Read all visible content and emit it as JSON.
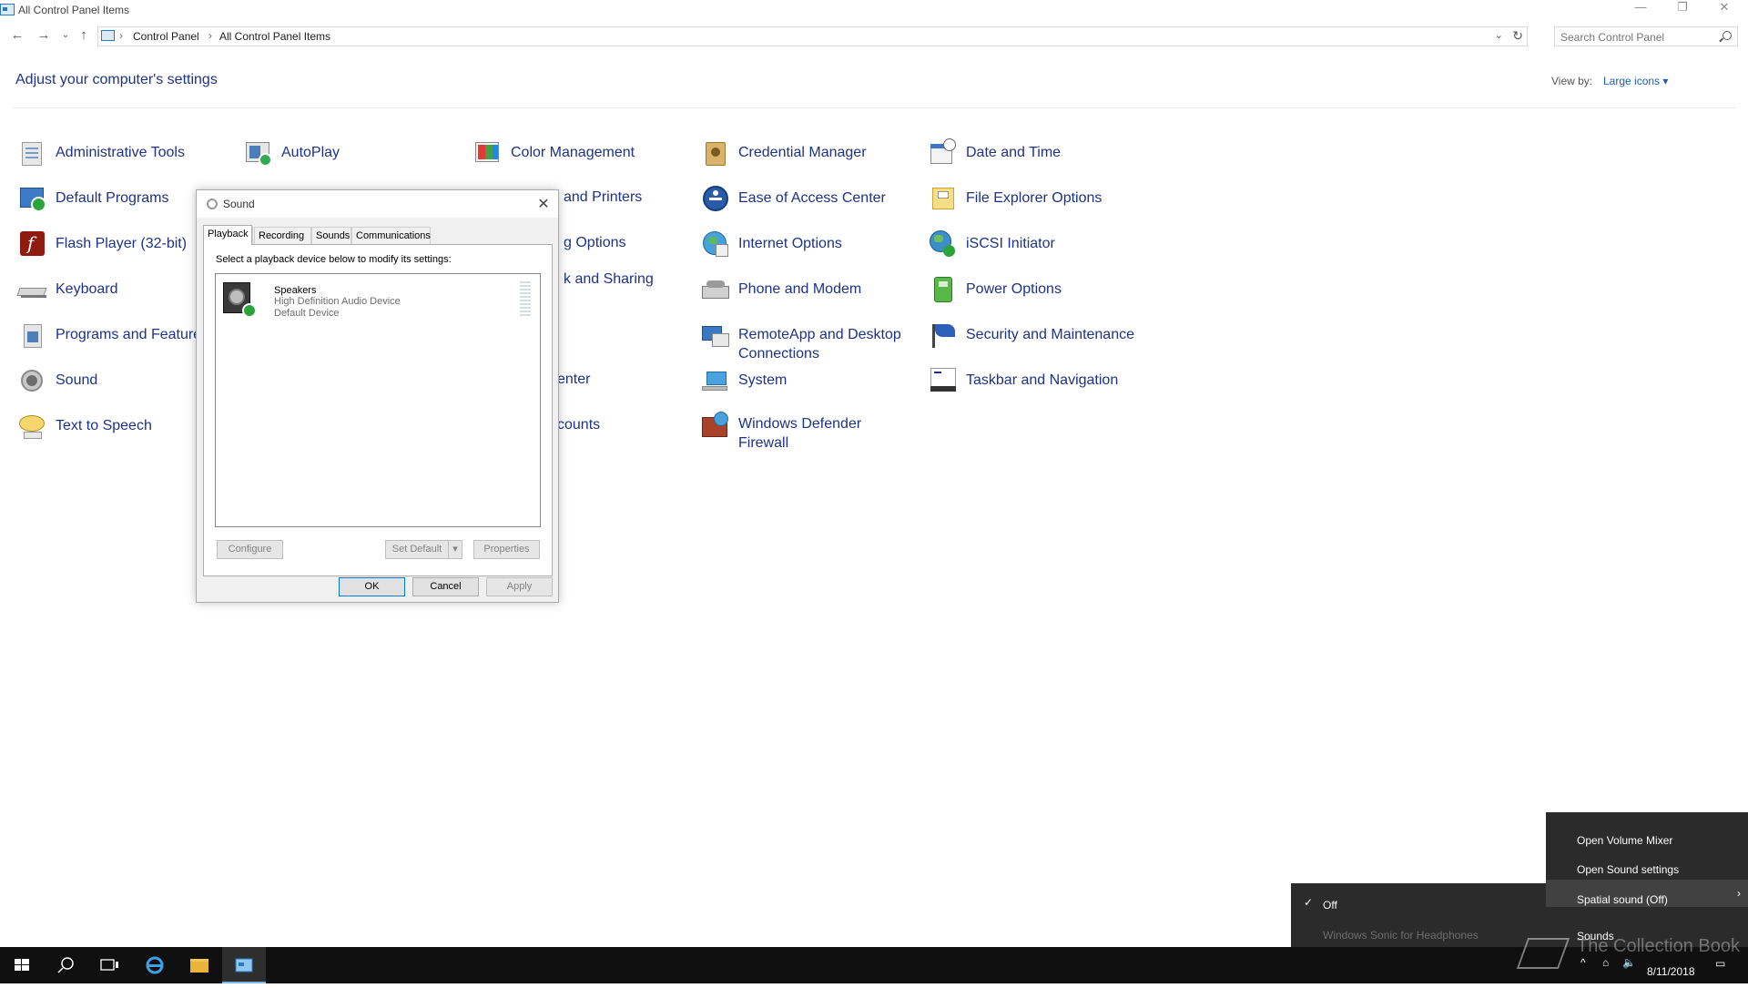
{
  "window": {
    "title": "All Control Panel Items",
    "minimize": "—",
    "restore": "❐",
    "close": "✕"
  },
  "address": {
    "crumbs": [
      "Control Panel",
      "All Control Panel Items"
    ],
    "separator": "›",
    "search_placeholder": "Search Control Panel"
  },
  "header": {
    "title": "Adjust your computer's settings",
    "view_by_label": "View by:",
    "view_by_value": "Large icons ▾"
  },
  "items": {
    "col1": [
      "Administrative Tools",
      "Default Programs",
      "Flash Player (32-bit)",
      "Keyboard",
      "Programs and Features",
      "Sound",
      "Text to Speech"
    ],
    "col2": [
      "AutoPlay"
    ],
    "col3": [
      "Color Management",
      "and Printers",
      "g Options",
      "k and Sharing",
      "enter",
      "counts"
    ],
    "col4": [
      "Credential Manager",
      "Ease of Access Center",
      "Internet Options",
      "Phone and Modem",
      "RemoteApp and Desktop",
      "Connections",
      "System",
      "Windows Defender",
      "Firewall"
    ],
    "col5": [
      "Date and Time",
      "File Explorer Options",
      "iSCSI Initiator",
      "Power Options",
      "Security and Maintenance",
      "Taskbar and Navigation"
    ]
  },
  "sound_dialog": {
    "title": "Sound",
    "close": "✕",
    "tabs": [
      "Playback",
      "Recording",
      "Sounds",
      "Communications"
    ],
    "instruction": "Select a playback device below to modify its settings:",
    "device": {
      "name": "Speakers",
      "description": "High Definition Audio Device",
      "status": "Default Device"
    },
    "buttons": {
      "configure": "Configure",
      "set_default": "Set Default",
      "properties": "Properties",
      "ok": "OK",
      "cancel": "Cancel",
      "apply": "Apply"
    }
  },
  "context_menu": {
    "items": [
      "Open Volume Mixer",
      "Open Sound settings",
      "Spatial sound (Off)",
      "Sounds"
    ],
    "arrow": "›"
  },
  "spatial_submenu": {
    "check": "✓",
    "items": [
      "Off",
      "Windows Sonic for Headphones"
    ]
  },
  "tray": {
    "date": "8/11/2018"
  },
  "watermark": "The Collection Book",
  "colors": {
    "link": "#1e3287",
    "taskbar": "#101010",
    "menu": "#2b2b2b",
    "accent": "#76b9ed"
  }
}
